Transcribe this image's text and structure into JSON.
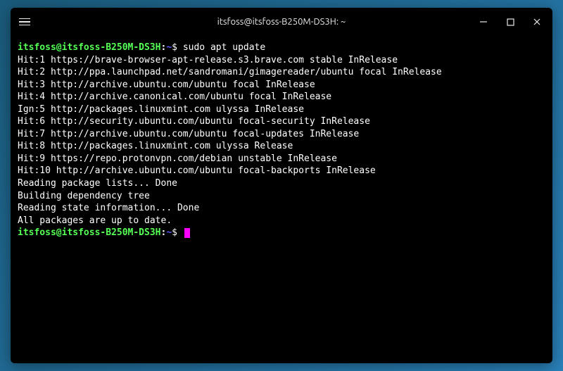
{
  "window": {
    "title": "itsfoss@itsfoss-B250M-DS3H: ~"
  },
  "prompt": {
    "user_host": "itsfoss@itsfoss-B250M-DS3H",
    "separator": ":",
    "path": "~",
    "symbol": "$"
  },
  "commands": {
    "cmd1": "sudo apt update"
  },
  "output": {
    "line1": "Hit:1 https://brave-browser-apt-release.s3.brave.com stable InRelease",
    "line2": "Hit:2 http://ppa.launchpad.net/sandromani/gimagereader/ubuntu focal InRelease",
    "line3": "Hit:3 http://archive.ubuntu.com/ubuntu focal InRelease",
    "line4": "Hit:4 http://archive.canonical.com/ubuntu focal InRelease",
    "line5": "Ign:5 http://packages.linuxmint.com ulyssa InRelease",
    "line6": "Hit:6 http://security.ubuntu.com/ubuntu focal-security InRelease",
    "line7": "Hit:7 http://archive.ubuntu.com/ubuntu focal-updates InRelease",
    "line8": "Hit:8 http://packages.linuxmint.com ulyssa Release",
    "line9": "Hit:9 https://repo.protonvpn.com/debian unstable InRelease",
    "line10": "Hit:10 http://archive.ubuntu.com/ubuntu focal-backports InRelease",
    "line11": "Reading package lists... Done",
    "line12": "Building dependency tree",
    "line13": "Reading state information... Done",
    "line14": "All packages are up to date."
  }
}
